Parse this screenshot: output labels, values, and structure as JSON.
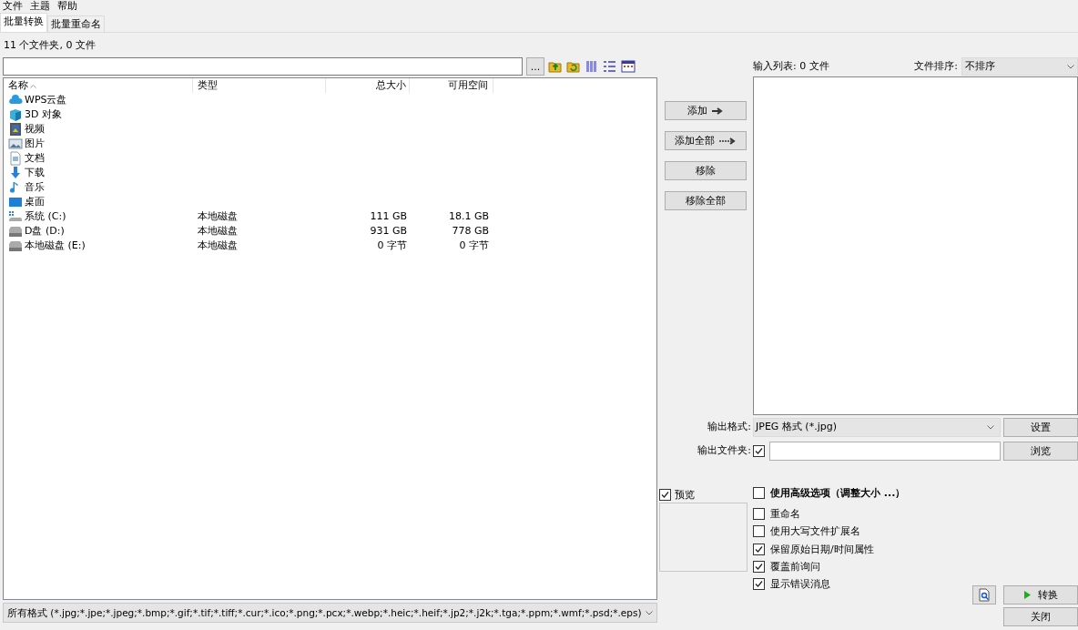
{
  "menu": [
    "文件",
    "主题",
    "帮助"
  ],
  "tabs": [
    {
      "label": "批量转换",
      "selected": true
    },
    {
      "label": "批量重命名",
      "selected": false
    }
  ],
  "status": "11 个文件夹, 0 文件",
  "path_bar": {
    "browse_button": "...",
    "tools": [
      {
        "kind": "up"
      },
      {
        "kind": "refresh"
      },
      {
        "kind": "grid"
      },
      {
        "kind": "details"
      },
      {
        "kind": "thumbs"
      }
    ]
  },
  "file_list": {
    "columns": [
      {
        "label": "名称",
        "sorted": true
      },
      {
        "label": "类型",
        "sorted": false
      },
      {
        "label": "总大小",
        "sorted": false
      },
      {
        "label": "可用空间",
        "sorted": false
      }
    ],
    "rows": [
      {
        "kind": "cloud",
        "name": "WPS云盘"
      },
      {
        "kind": "cube",
        "name": "3D 对象"
      },
      {
        "kind": "video",
        "name": "视频"
      },
      {
        "kind": "pictures",
        "name": "图片"
      },
      {
        "kind": "document",
        "name": "文档"
      },
      {
        "kind": "download",
        "name": "下载"
      },
      {
        "kind": "music",
        "name": "音乐"
      },
      {
        "kind": "desktop",
        "name": "桌面"
      },
      {
        "kind": "system-drive",
        "name": "系统 (C:)",
        "type": "本地磁盘",
        "total": "111 GB",
        "free": "18.1 GB"
      },
      {
        "kind": "drive",
        "name": "D盘 (D:)",
        "type": "本地磁盘",
        "total": "931 GB",
        "free": "778 GB"
      },
      {
        "kind": "drive",
        "name": "本地磁盘 (E:)",
        "type": "本地磁盘",
        "total": "0 字节",
        "free": "0 字节"
      }
    ]
  },
  "filter": "所有格式 (*.jpg;*.jpe;*.jpeg;*.bmp;*.gif;*.tif;*.tiff;*.cur;*.ico;*.png;*.pcx;*.webp;*.heic;*.heif;*.jp2;*.j2k;*.tga;*.ppm;*.wmf;*.psd;*.eps)",
  "transfer_buttons": [
    {
      "label": "添加",
      "kind": "arrow"
    },
    {
      "label": "添加全部",
      "kind": "long-arrow"
    },
    {
      "label": "移除",
      "kind": "plain"
    },
    {
      "label": "移除全部",
      "kind": "plain"
    }
  ],
  "input_list": {
    "title": "输入列表: 0 文件",
    "sort_label": "文件排序:",
    "sort_value": "不排序"
  },
  "output_format": {
    "label": "输出格式:",
    "value": "JPEG 格式 (*.jpg)",
    "button": "设置"
  },
  "output_folder": {
    "label": "输出文件夹:",
    "checked": true,
    "button": "浏览"
  },
  "preview": {
    "label": "预览",
    "checked": true
  },
  "options": [
    {
      "kind": "header",
      "label": "使用高级选项（调整大小 ...）",
      "checked": false
    },
    {
      "kind": "option",
      "label": "重命名",
      "checked": false
    },
    {
      "kind": "option",
      "label": "使用大写文件扩展名",
      "checked": false
    },
    {
      "kind": "option",
      "label": "保留原始日期/时间属性",
      "checked": true
    },
    {
      "kind": "option",
      "label": "覆盖前询问",
      "checked": true
    },
    {
      "kind": "option",
      "label": "显示错误消息",
      "checked": true
    }
  ],
  "actions": {
    "convert": "转换",
    "close": "关闭"
  }
}
